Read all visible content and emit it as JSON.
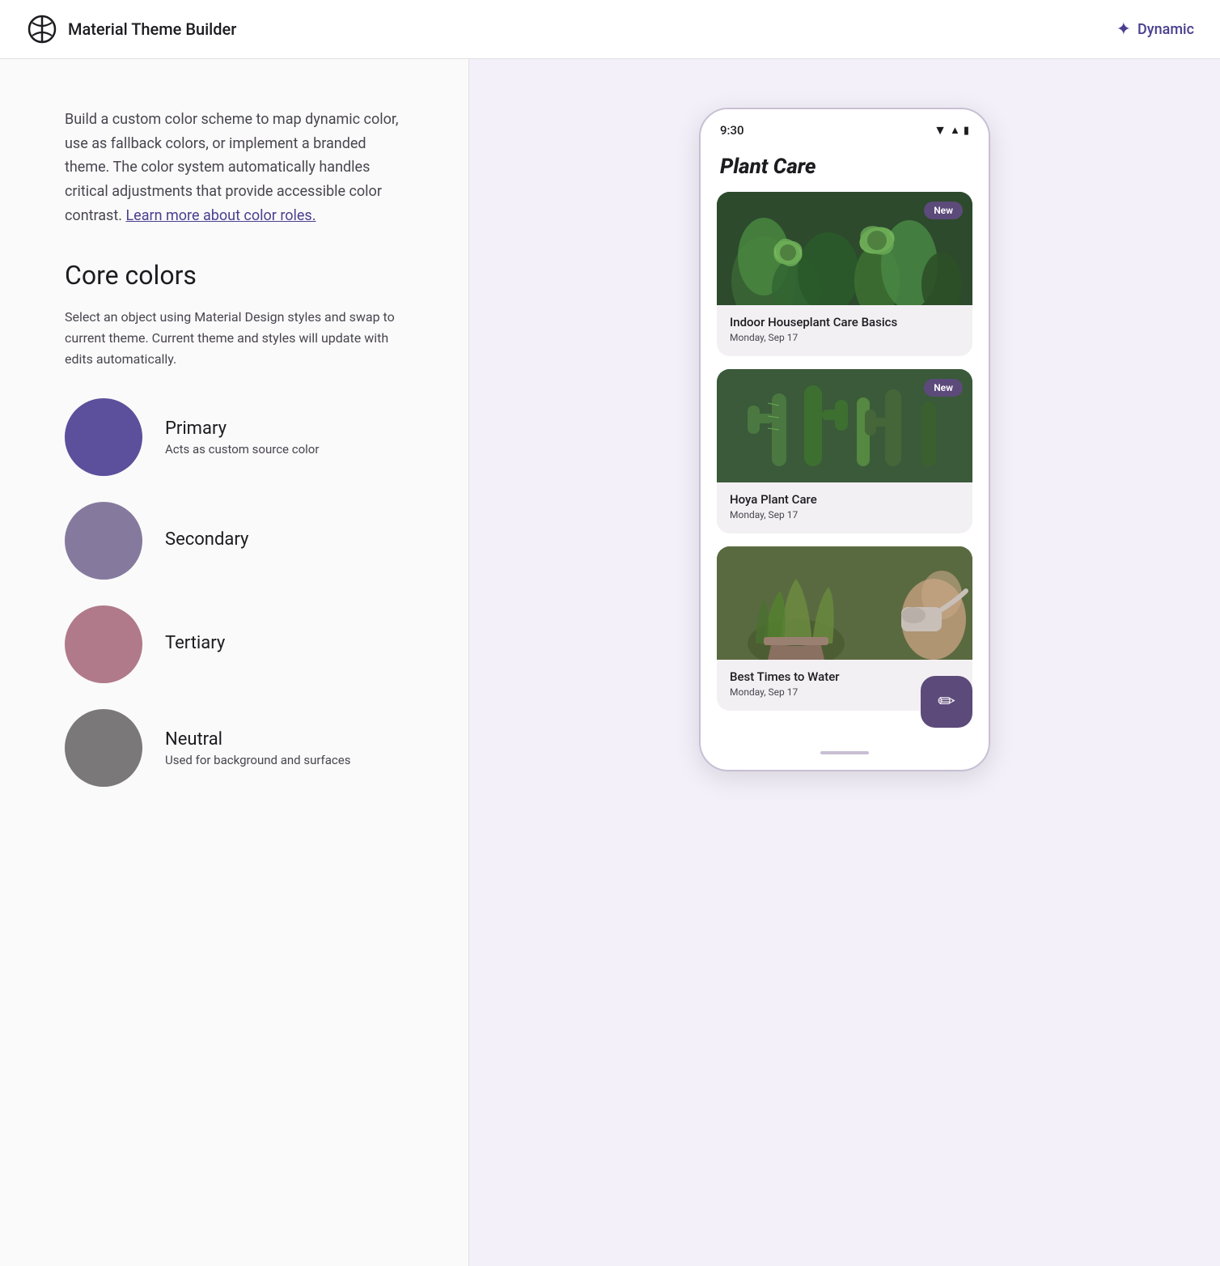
{
  "header": {
    "logo_alt": "Material logo",
    "title": "Material Theme Builder",
    "dynamic_label": "Dynamic"
  },
  "left_panel": {
    "intro": "Build a custom color scheme to map dynamic color, use as fallback colors, or implement a branded theme. The color system automatically handles critical adjustments that provide accessible color contrast.",
    "learn_more_link": "Learn more about color roles.",
    "core_colors_title": "Core colors",
    "core_colors_subtitle": "Select an object using Material Design styles and swap to current theme. Current theme and styles will update with edits automatically.",
    "colors": [
      {
        "name": "Primary",
        "desc": "Acts as custom source color",
        "color": "#5c4f9b"
      },
      {
        "name": "Secondary",
        "desc": "",
        "color": "#857a9e"
      },
      {
        "name": "Tertiary",
        "desc": "",
        "color": "#b07a8a"
      },
      {
        "name": "Neutral",
        "desc": "Used for background and surfaces",
        "color": "#7a7878"
      }
    ]
  },
  "phone": {
    "status_time": "9:30",
    "app_title": "Plant Care",
    "cards": [
      {
        "title": "Indoor Houseplant Care Basics",
        "date": "Monday, Sep 17",
        "has_badge": true,
        "badge_text": "New"
      },
      {
        "title": "Hoya Plant Care",
        "date": "Monday, Sep 17",
        "has_badge": true,
        "badge_text": "New"
      },
      {
        "title": "Best Times to Water",
        "date": "Monday, Sep 17",
        "has_badge": false
      }
    ],
    "fab_icon": "✏"
  }
}
